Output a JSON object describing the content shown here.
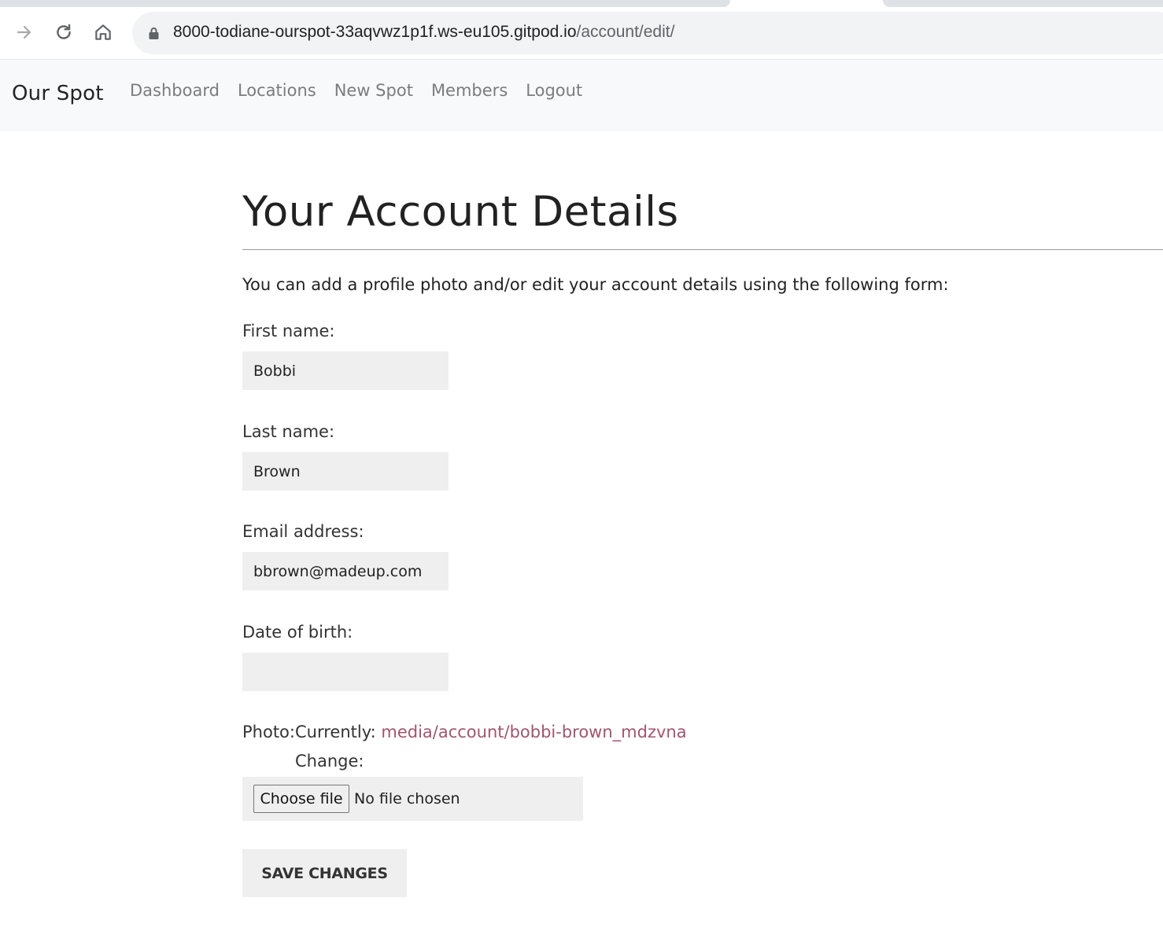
{
  "browser": {
    "url_host": "8000-todiane-ourspot-33aqvwz1p1f.ws-eu105.gitpod.io",
    "url_path": "/account/edit/"
  },
  "nav": {
    "brand": "Our Spot",
    "links": [
      "Dashboard",
      "Locations",
      "New Spot",
      "Members",
      "Logout"
    ]
  },
  "page": {
    "title": "Your Account Details",
    "intro": "You can add a profile photo and/or edit your account details using the following form:"
  },
  "form": {
    "first_name": {
      "label": "First name:",
      "value": "Bobbi"
    },
    "last_name": {
      "label": "Last name:",
      "value": "Brown"
    },
    "email": {
      "label": "Email address:",
      "value": "bbrown@madeup.com"
    },
    "dob": {
      "label": "Date of birth:",
      "value": ""
    },
    "photo": {
      "label": "Photo:",
      "currently_label": "Currently:",
      "current_file": "media/account/bobbi-brown_mdzvna",
      "change_label": "Change:",
      "choose_button": "Choose file",
      "status": "No file chosen"
    },
    "submit": "SAVE CHANGES"
  },
  "colors": {
    "link": "#a1566e",
    "nav_bg": "#f8f9fa",
    "input_bg": "#efefef"
  }
}
